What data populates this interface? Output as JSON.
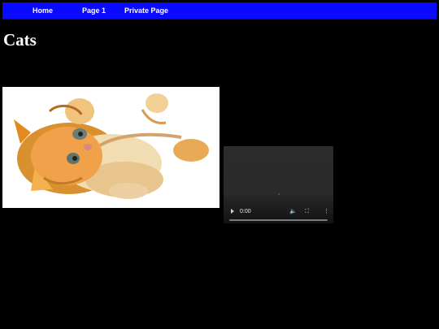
{
  "nav": {
    "home": "Home",
    "page1": "Page 1",
    "private": "Private Page"
  },
  "page": {
    "title": "Cats"
  },
  "video": {
    "time": "0:00",
    "play_icon": "play-icon",
    "volume_icon": "volume-icon",
    "fullscreen_icon": "fullscreen-icon",
    "more_icon": "more-options-icon",
    "progress": 0
  },
  "colors": {
    "nav_background": "#0a0aff",
    "page_background": "#000000",
    "text": "#ffffff"
  }
}
